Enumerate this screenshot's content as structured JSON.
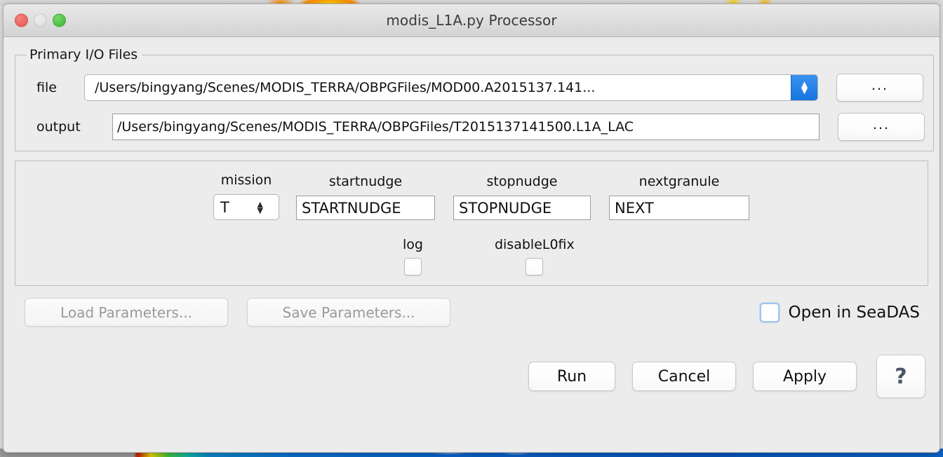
{
  "window": {
    "title": "modis_L1A.py Processor",
    "traffic_lights": [
      {
        "name": "close",
        "color": "#e8645c"
      },
      {
        "name": "minimize",
        "color": "#e0e0e0"
      },
      {
        "name": "maximize",
        "color": "#4cbf42"
      }
    ]
  },
  "io_group": {
    "legend": "Primary I/O Files",
    "file": {
      "label": "file",
      "value": "/Users/bingyang/Scenes/MODIS_TERRA/OBPGFiles/MOD00.A2015137.141...",
      "stepper_up": "▲",
      "stepper_down": "▼",
      "browse_label": "...",
      "accent": "#1675e0"
    },
    "output": {
      "label": "output",
      "value": "/Users/bingyang/Scenes/MODIS_TERRA/OBPGFiles/T2015137141500.L1A_LAC",
      "browse_label": "..."
    }
  },
  "params_group": {
    "fields": [
      {
        "caption": "mission",
        "value": "T",
        "type": "spinner"
      },
      {
        "caption": "startnudge",
        "value": "STARTNUDGE",
        "type": "text"
      },
      {
        "caption": "stopnudge",
        "value": "STOPNUDGE",
        "type": "text"
      },
      {
        "caption": "nextgranule",
        "value": "NEXT",
        "type": "text"
      }
    ],
    "checkboxes": [
      {
        "caption": "log",
        "checked": false
      },
      {
        "caption": "disableL0fix",
        "checked": false
      }
    ]
  },
  "footer": {
    "load_parameters": "Load Parameters...",
    "save_parameters": "Save Parameters...",
    "open_in_seadas": {
      "label": "Open in SeaDAS",
      "checked": false,
      "focus_ring": "#9cc6f2"
    },
    "run": "Run",
    "cancel": "Cancel",
    "apply": "Apply",
    "help": "?"
  }
}
